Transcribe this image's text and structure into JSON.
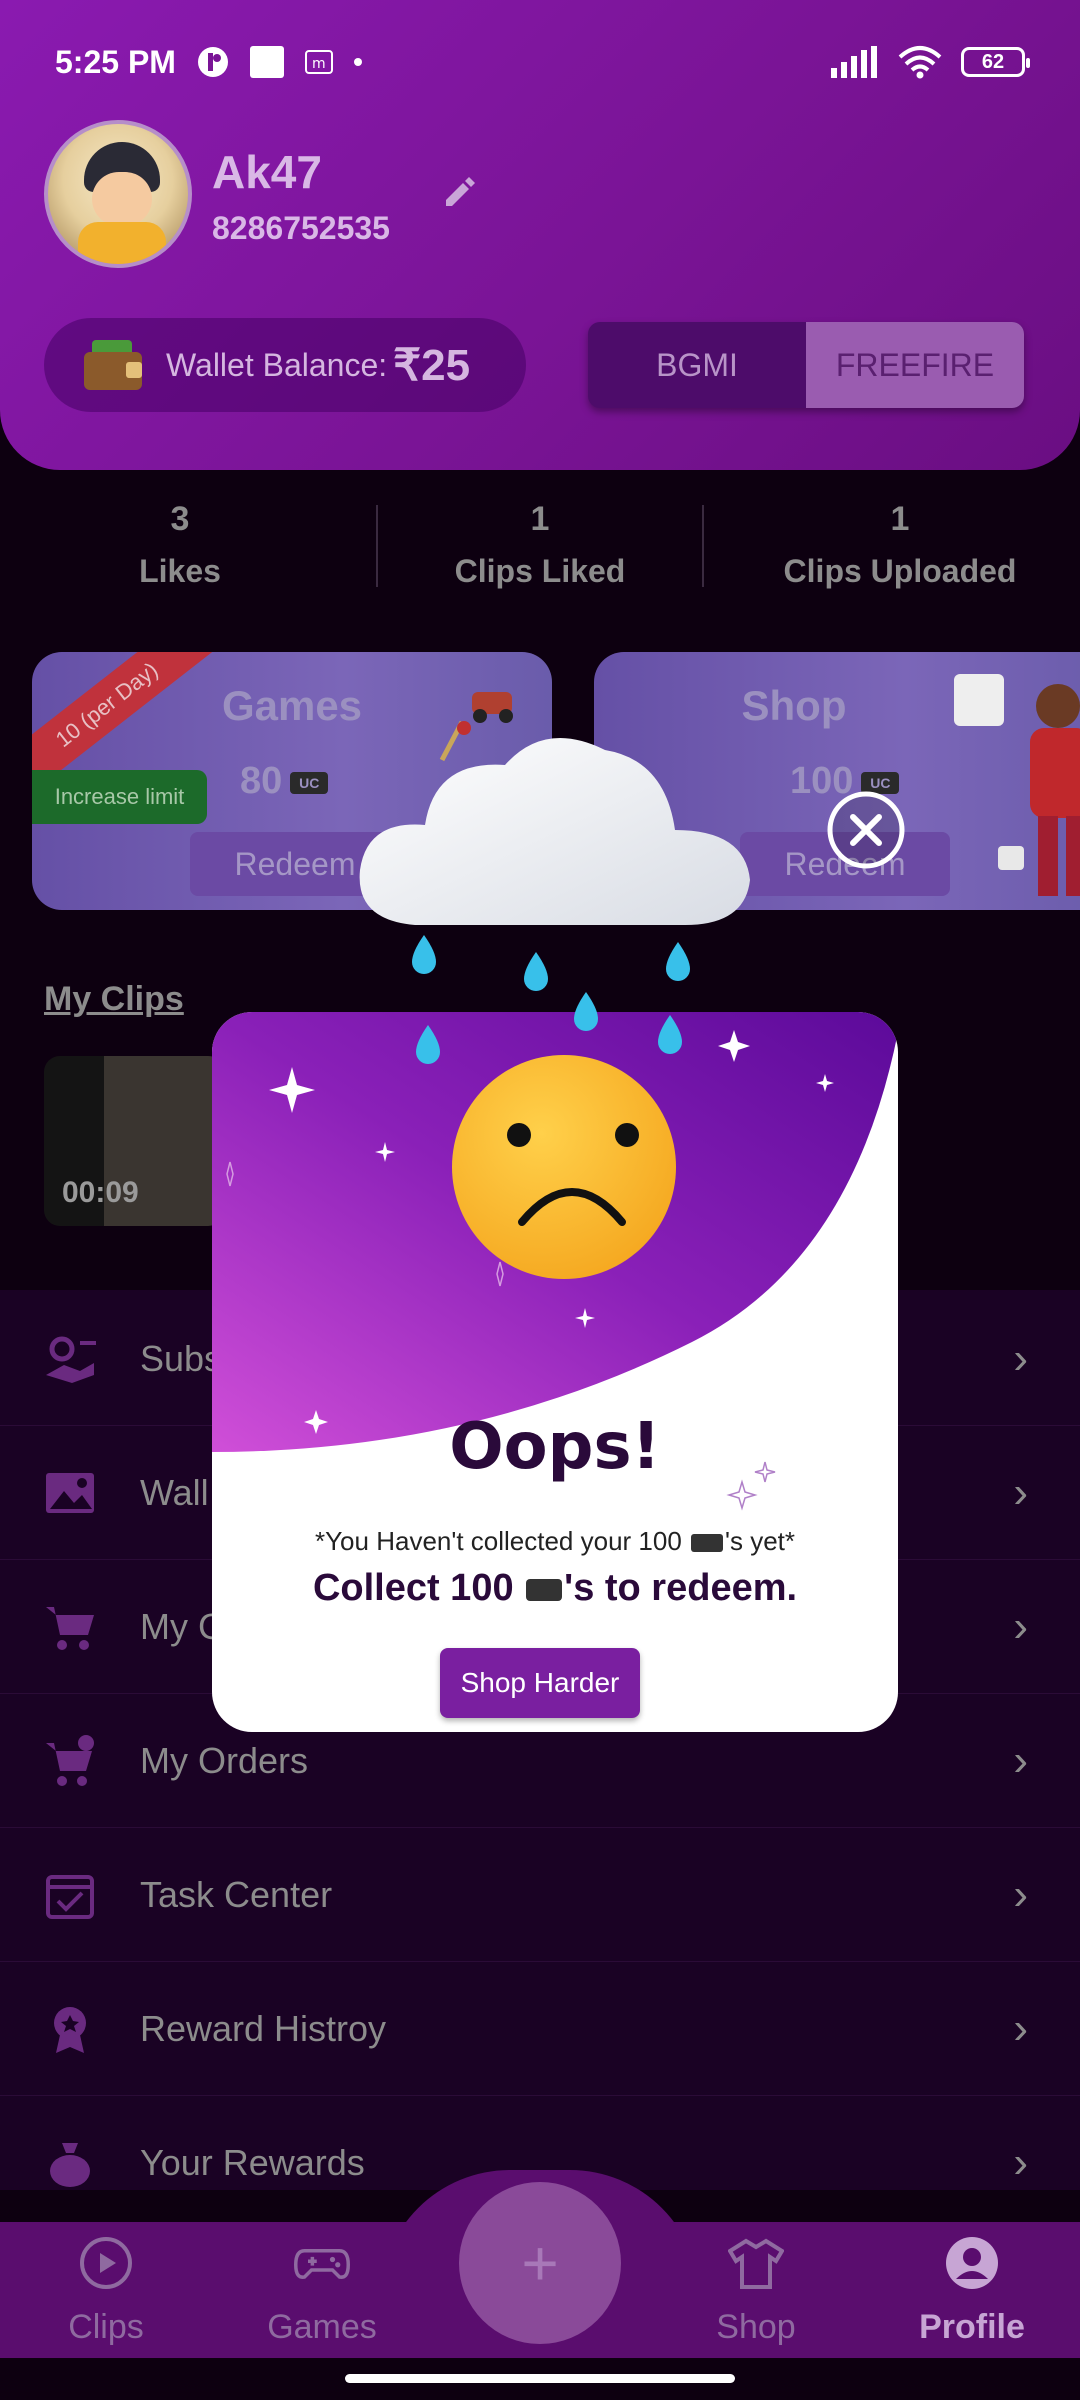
{
  "status": {
    "time": "5:25 PM",
    "battery": "62"
  },
  "profile": {
    "name": "Ak47",
    "phone": "8286752535"
  },
  "wallet": {
    "label": "Wallet Balance:",
    "amount": "₹25"
  },
  "toggle": {
    "left": "BGMI",
    "right": "FREEFIRE",
    "selected": "FREEFIRE"
  },
  "stats": [
    {
      "value": "3",
      "label": "Likes"
    },
    {
      "value": "1",
      "label": "Clips Liked"
    },
    {
      "value": "1",
      "label": "Clips Uploaded"
    }
  ],
  "cards": {
    "games": {
      "title": "Games",
      "points": "80",
      "ribbon": "10 (per Day)",
      "increase": "Increase limit",
      "redeem": "Redeem"
    },
    "shop": {
      "title": "Shop",
      "points": "100",
      "redeem": "Redeem"
    }
  },
  "my_clips": {
    "title": "My Clips",
    "clips": [
      {
        "duration": "00:09"
      }
    ]
  },
  "menu": [
    {
      "label": "Subs",
      "icon": "subscription-icon"
    },
    {
      "label": "Wall",
      "icon": "wallpaper-icon"
    },
    {
      "label": "My C",
      "icon": "cart-icon"
    },
    {
      "label": "My Orders",
      "icon": "orders-icon"
    },
    {
      "label": "Task Center",
      "icon": "calendar-check-icon"
    },
    {
      "label": "Reward Histroy",
      "icon": "award-icon"
    },
    {
      "label": "Your Rewards",
      "icon": "money-bag-icon"
    }
  ],
  "nav": [
    {
      "label": "Clips",
      "icon": "play-icon"
    },
    {
      "label": "Games",
      "icon": "gamepad-icon"
    },
    {
      "label": "+",
      "icon": "plus-icon"
    },
    {
      "label": "Shop",
      "icon": "tshirt-icon"
    },
    {
      "label": "Profile",
      "icon": "user-icon"
    }
  ],
  "modal": {
    "title": "Oops!",
    "message_pre": "*You Haven't collected your 100 ",
    "message_post": "'s yet*",
    "cta_pre": "Collect 100 ",
    "cta_post": "'s to redeem.",
    "button": "Shop Harder"
  },
  "colors": {
    "header": "#7a1496",
    "menu_bg": "#1a0224",
    "nav_bg": "#5a0d6e",
    "modal_button": "#7a1fa0"
  }
}
